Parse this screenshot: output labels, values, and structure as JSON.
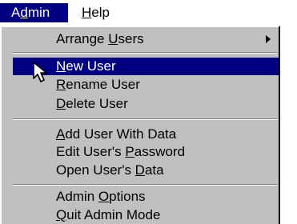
{
  "menubar": {
    "admin": {
      "pre": "A",
      "accel": "d",
      "post": "min"
    },
    "help": {
      "pre": "",
      "accel": "H",
      "post": "elp"
    }
  },
  "menu": {
    "arrange_users": {
      "pre": "Arrange ",
      "accel": "U",
      "post": "sers"
    },
    "new_user": {
      "pre": "",
      "accel": "N",
      "post": "ew User"
    },
    "rename_user": {
      "pre": "",
      "accel": "R",
      "post": "ename User"
    },
    "delete_user": {
      "pre": "",
      "accel": "D",
      "post": "elete User"
    },
    "add_user_with_data": {
      "pre": "",
      "accel": "A",
      "post": "dd User With Data"
    },
    "edit_password": {
      "pre": "Edit User's ",
      "accel": "P",
      "post": "assword"
    },
    "open_user_data": {
      "pre": "Open User's ",
      "accel": "D",
      "post": "ata"
    },
    "admin_options": {
      "pre": "Admin ",
      "accel": "O",
      "post": "ptions"
    },
    "quit_admin": {
      "pre": "",
      "accel": "Q",
      "post": "uit Admin Mode"
    }
  },
  "colors": {
    "highlight": "#000080",
    "menu_bg": "#c0c0c0"
  },
  "icons": {
    "cursor": "mouse-pointer-icon",
    "submenu": "triangle-right-icon"
  }
}
